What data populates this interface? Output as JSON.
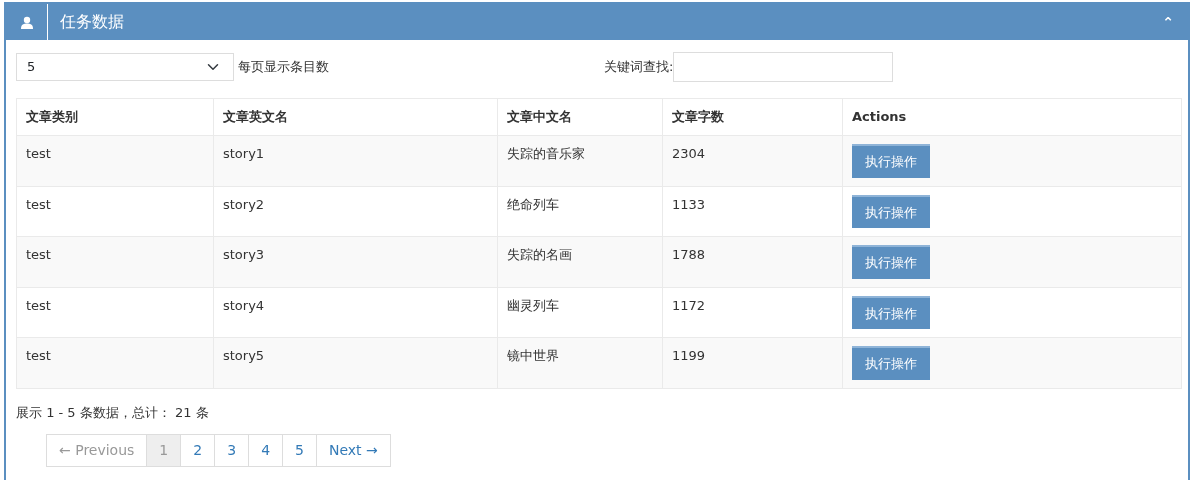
{
  "panel": {
    "title": "任务数据",
    "collapse_icon": "⌃"
  },
  "length": {
    "value": "5",
    "label": "每页显示条目数"
  },
  "search": {
    "label": "关键词查找:"
  },
  "table": {
    "columns": [
      "文章类别",
      "文章英文名",
      "文章中文名",
      "文章字数",
      "Actions"
    ],
    "rows": [
      {
        "cells": [
          "test",
          "story1",
          "失踪的音乐家",
          "2304"
        ],
        "action": "执行操作"
      },
      {
        "cells": [
          "test",
          "story2",
          "绝命列车",
          "1133"
        ],
        "action": "执行操作"
      },
      {
        "cells": [
          "test",
          "story3",
          "失踪的名画",
          "1788"
        ],
        "action": "执行操作"
      },
      {
        "cells": [
          "test",
          "story4",
          "幽灵列车",
          "1172"
        ],
        "action": "执行操作"
      },
      {
        "cells": [
          "test",
          "story5",
          "镜中世界",
          "1199"
        ],
        "action": "执行操作"
      }
    ]
  },
  "info": "展示 1 - 5 条数据，总计： 21 条",
  "pagination": [
    {
      "label": "← Previous",
      "selected": false,
      "disabled": true
    },
    {
      "label": "1",
      "selected": true,
      "disabled": false
    },
    {
      "label": "2",
      "selected": false,
      "disabled": false
    },
    {
      "label": "3",
      "selected": false,
      "disabled": false
    },
    {
      "label": "4",
      "selected": false,
      "disabled": false
    },
    {
      "label": "5",
      "selected": false,
      "disabled": false
    },
    {
      "label": "Next →",
      "selected": false,
      "disabled": false
    }
  ]
}
